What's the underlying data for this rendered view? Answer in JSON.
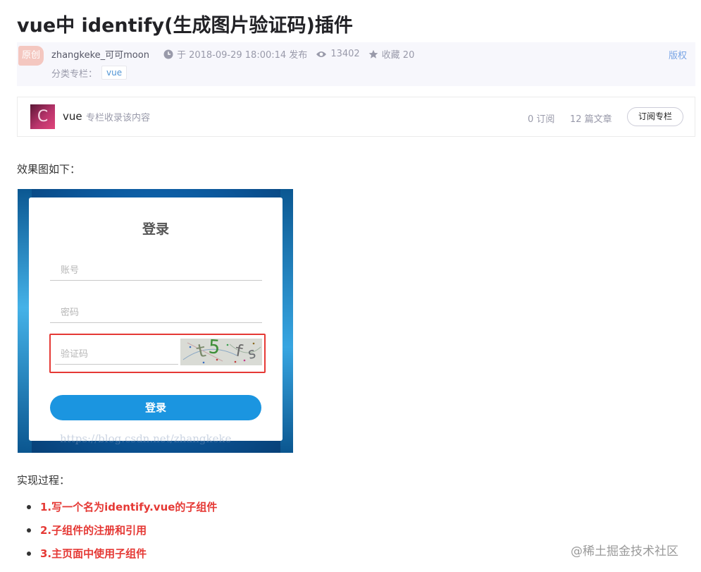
{
  "article": {
    "title": "vue中 identify(生成图片验证码)插件",
    "badge": "原创",
    "author": "zhangkeke_可可moon",
    "published": "于 2018-09-29 18:00:14 发布",
    "views": "13402",
    "favorites": "收藏 20",
    "copyright": "版权",
    "category_label": "分类专栏：",
    "category_tag": "vue"
  },
  "column": {
    "avatar_letter": "C",
    "name": "vue",
    "description": "专栏收录该内容",
    "subscriptions": "0 订阅",
    "article_count": "12 篇文章",
    "subscribe_button": "订阅专栏"
  },
  "content": {
    "intro": "效果图如下：",
    "process_heading": "实现过程：",
    "steps": [
      "1.写一个名为identify.vue的子组件",
      "2.子组件的注册和引用",
      "3.主页面中使用子组件"
    ]
  },
  "screenshot": {
    "title": "登录",
    "account_placeholder": "账号",
    "password_placeholder": "密码",
    "captcha_placeholder": "验证码",
    "captcha_chars": [
      "t",
      "5",
      "f",
      "s"
    ],
    "login_button": "登录",
    "watermark": "https://blog.csdn.net/zhangkeke"
  },
  "footer": {
    "watermark": "@稀土掘金技术社区"
  },
  "colors": {
    "step_red": "#e53935",
    "link_blue": "#5094d5",
    "button_blue": "#1b95e0"
  }
}
